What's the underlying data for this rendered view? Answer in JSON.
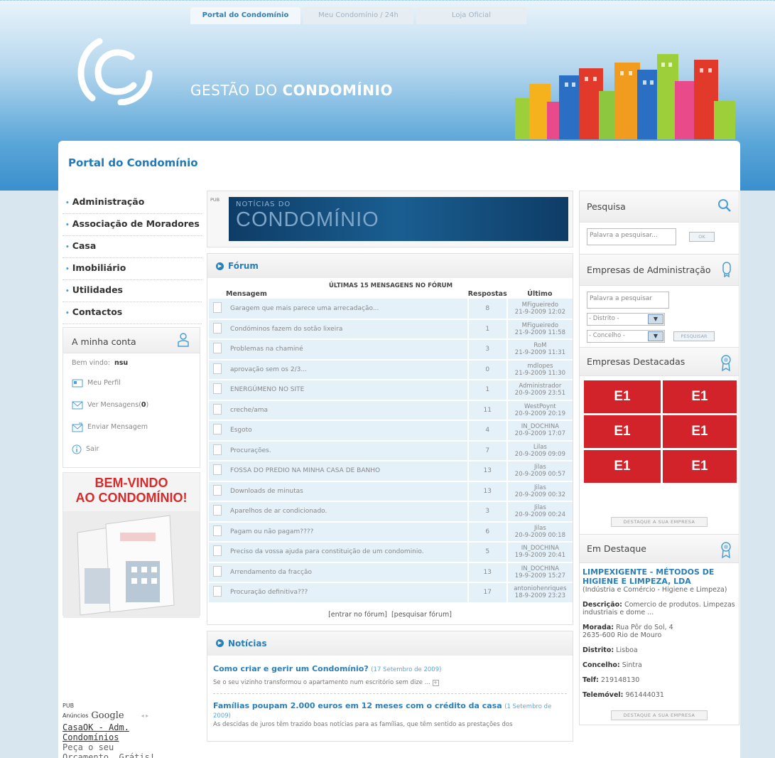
{
  "top_tabs": [
    "Portal do Condomínio",
    "Meu Condomínio / 24h",
    "Loja Oficial"
  ],
  "brand": {
    "light": "GESTÃO DO ",
    "bold": "CONDOMÍNIO"
  },
  "page_title": "Portal do Condomínio",
  "nav": [
    "Administração",
    "Associação de Moradores",
    "Casa",
    "Imobiliário",
    "Utilidades",
    "Contactos"
  ],
  "account": {
    "title": "A minha conta",
    "welcome_label": "Bem vindo:",
    "username": "nsu",
    "profile": "Meu Perfil",
    "messages_label": "Ver Mensagens(",
    "messages_count": "0",
    "messages_close": ")",
    "send": "Enviar Mensagem",
    "logout": "Sair"
  },
  "promo": {
    "line1": "BEM-VINDO",
    "line2": "AO CONDOMÍNIO!"
  },
  "ad": {
    "pub": "PUB",
    "google_prefix": "Anúncios",
    "google": "Google",
    "link1": "CasaOK - Adm.",
    "link2": "Condomínios",
    "desc1": "Peça o seu",
    "desc2": "Orçamento, Grátis!"
  },
  "pub_banner": {
    "label": "PUB",
    "small": "NOTÍCIAS DO",
    "large": "CONDOMÍNIO"
  },
  "forum": {
    "title": "Fórum",
    "caption": "ÚLTIMAS 15 MENSAGENS NO FÓRUM",
    "col_msg": "Mensagem",
    "col_rep": "Respostas",
    "col_last": "Último",
    "rows": [
      {
        "msg": "Garagem que mais parece uma arrecadação...",
        "rep": "8",
        "user": "MFigueiredo",
        "date": "21-9-2009 12:02"
      },
      {
        "msg": "Condóminos fazem do sotão lixeira",
        "rep": "1",
        "user": "MFigueiredo",
        "date": "21-9-2009 11:58"
      },
      {
        "msg": "Problemas na chaminé",
        "rep": "3",
        "user": "RoM",
        "date": "21-9-2009 11:31"
      },
      {
        "msg": "aprovação sem os 2/3...",
        "rep": "0",
        "user": "mdlopes",
        "date": "21-9-2009 11:30"
      },
      {
        "msg": "ENERGÚMENO NO SITE",
        "rep": "1",
        "user": "Administrador",
        "date": "20-9-2009 23:51"
      },
      {
        "msg": "creche/ama",
        "rep": "11",
        "user": "WestPoynt",
        "date": "20-9-2009 20:19"
      },
      {
        "msg": "Esgoto",
        "rep": "4",
        "user": "IN_DOCHINA",
        "date": "20-9-2009 17:07"
      },
      {
        "msg": "Procurações.",
        "rep": "7",
        "user": "Lilas",
        "date": "20-9-2009 09:09"
      },
      {
        "msg": "FOSSA DO PREDIO NA MINHA CASA DE BANHO",
        "rep": "13",
        "user": "Jilas",
        "date": "20-9-2009 00:57"
      },
      {
        "msg": "Downloads de minutas",
        "rep": "13",
        "user": "Jilas",
        "date": "20-9-2009 00:32"
      },
      {
        "msg": "Aparelhos de ar condicionado.",
        "rep": "3",
        "user": "Jilas",
        "date": "20-9-2009 00:24"
      },
      {
        "msg": "Pagam ou não pagam????",
        "rep": "6",
        "user": "Jilas",
        "date": "20-9-2009 00:18"
      },
      {
        "msg": "Preciso da vossa ajuda para constituição de um condominio.",
        "rep": "5",
        "user": "IN_DOCHINA",
        "date": "19-9-2009 20:41"
      },
      {
        "msg": "Arrendamento da fracção",
        "rep": "13",
        "user": "IN_DOCHINA",
        "date": "19-9-2009 15:27"
      },
      {
        "msg": "Procuração definitiva???",
        "rep": "17",
        "user": "antoniohenriques",
        "date": "18-9-2009 23:23"
      }
    ],
    "enter": "[entrar no fórum]",
    "search": "[pesquisar fórum]"
  },
  "news": {
    "title": "Notícias",
    "items": [
      {
        "title": "Como criar e gerir um Condomínio?",
        "date": "(17 Setembro de 2009)",
        "text": "Se o seu vizinho transformou o apartamento num escritório sem dize ..."
      },
      {
        "title": "Famílias poupam 2.000 euros em 12 meses com o crédito da casa",
        "date": "(1 Setembro de 2009)",
        "text": "As descidas de juros têm trazido boas notícias para as famílias, que têm sentido as prestações dos"
      }
    ]
  },
  "search": {
    "title": "Pesquisa",
    "placeholder": "Palavra a pesquisar...",
    "button": "OK"
  },
  "companies": {
    "title": "Empresas de Administração",
    "placeholder": "Palavra a pesquisar",
    "district": "- Distrito -",
    "county": "- Concelho -",
    "button": "PESQUISAR"
  },
  "featured": {
    "title": "Empresas Destacadas",
    "tiles": [
      "E1",
      "E1",
      "E1",
      "E1",
      "E1",
      "E1"
    ],
    "button": "DESTAQUE A SUA EMPRESA"
  },
  "highlight": {
    "title": "Em Destaque",
    "name": "LIMPEXIGENTE - MÉTODOS DE HIGIENE E LIMPEZA, LDA",
    "sector": "(Indústria e Comércio - Higiene e Limpeza)",
    "desc_label": "Descrição:",
    "desc": "Comercio de produtos. Limpezas industriais e dome ...",
    "address_label": "Morada:",
    "address": "Rua Pôr do Sol, 4",
    "address2": "2635-600 Rio de Mouro",
    "district_label": "Distrito:",
    "district": "Lisboa",
    "county_label": "Concelho:",
    "county": "Sintra",
    "phone_label": "Telf:",
    "phone": "219148130",
    "mobile_label": "Telemóvel:",
    "mobile": "961444031",
    "button": "DESTAQUE A SUA EMPRESA"
  },
  "colors": {
    "accent": "#2a7fb8",
    "red": "#d2232a",
    "row_bg": "#e5f1f8"
  }
}
